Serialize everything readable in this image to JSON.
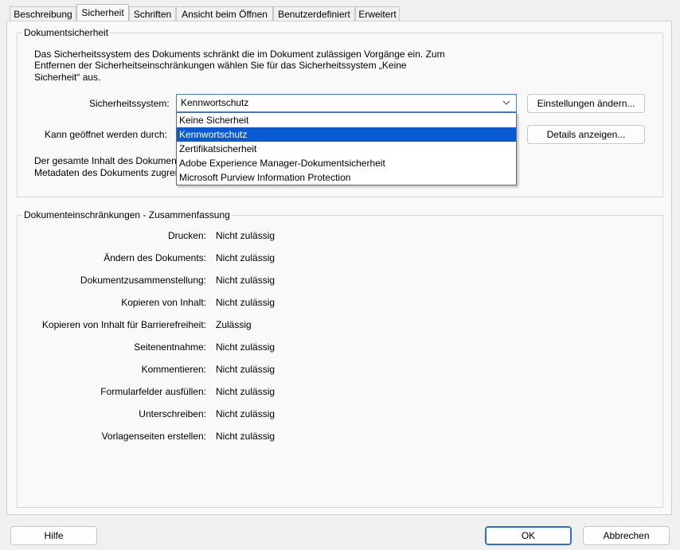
{
  "tabs": [
    "Beschreibung",
    "Sicherheit",
    "Schriften",
    "Ansicht beim Öffnen",
    "Benutzerdefiniert",
    "Erweitert"
  ],
  "active_tab": "Sicherheit",
  "security_group": {
    "title": "Dokumentsicherheit",
    "description_lines": [
      "Das Sicherheitssystem des Dokuments schränkt die im Dokument zulässigen Vorgänge ein. Zum",
      "Entfernen der Sicherheitseinschränkungen wählen Sie für das Sicherheitssystem „Keine",
      "Sicherheit“ aus."
    ],
    "system_label": "Sicherheitssystem:",
    "system_value": "Kennwortschutz",
    "open_by_label": "Kann geöffnet werden durch:",
    "content_lines": [
      "Der gesamte Inhalt des Dokument",
      "Metadaten des Dokuments zugrei"
    ],
    "change_settings_button": "Einstellungen ändern...",
    "show_details_button": "Details anzeigen...",
    "dropdown_options": [
      "Keine Sicherheit",
      "Kennwortschutz",
      "Zertifikatsicherheit",
      "Adobe Experience Manager-Dokumentsicherheit",
      "Microsoft Purview Information Protection"
    ],
    "dropdown_selected": "Kennwortschutz"
  },
  "restrictions_group": {
    "title": "Dokumenteinschränkungen - Zusammenfassung",
    "rows": [
      {
        "label": "Drucken:",
        "value": "Nicht zulässig"
      },
      {
        "label": "Ändern des Dokuments:",
        "value": "Nicht zulässig"
      },
      {
        "label": "Dokumentzusammenstellung:",
        "value": "Nicht zulässig"
      },
      {
        "label": "Kopieren von Inhalt:",
        "value": "Nicht zulässig"
      },
      {
        "label": "Kopieren von Inhalt für Barrierefreiheit:",
        "value": "Zulässig"
      },
      {
        "label": "Seitenentnahme:",
        "value": "Nicht zulässig"
      },
      {
        "label": "Kommentieren:",
        "value": "Nicht zulässig"
      },
      {
        "label": "Formularfelder ausfüllen:",
        "value": "Nicht zulässig"
      },
      {
        "label": "Unterschreiben:",
        "value": "Nicht zulässig"
      },
      {
        "label": "Vorlagenseiten erstellen:",
        "value": "Nicht zulässig"
      }
    ]
  },
  "footer": {
    "help_button": "Hilfe",
    "ok_button": "OK",
    "cancel_button": "Abbrechen"
  },
  "colors": {
    "accent": "#0a5bd3",
    "focus_border": "#4a7ec6"
  }
}
